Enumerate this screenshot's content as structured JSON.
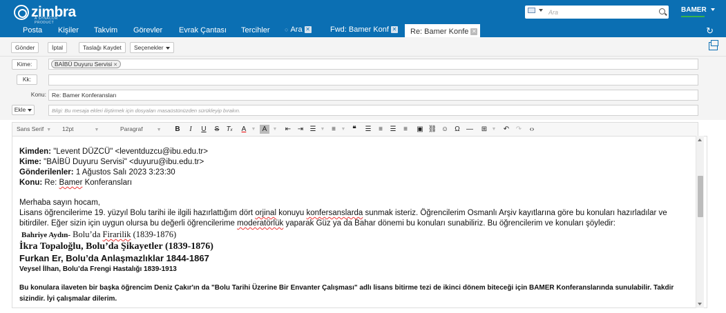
{
  "header": {
    "logo_text": "zimbra",
    "logo_subtext": "A SYNACOR PRODUCT",
    "search_placeholder": "Ara",
    "user_name": "BAMER"
  },
  "nav": {
    "items": [
      "Posta",
      "Kişiler",
      "Takvim",
      "Görevler",
      "Evrak Çantası",
      "Tercihler"
    ],
    "tabs": [
      {
        "label": "Ara",
        "active": false
      },
      {
        "label": "Fwd: Bamer Konf",
        "active": false
      },
      {
        "label": "Re: Bamer Konfe",
        "active": true
      }
    ]
  },
  "toolbar": {
    "send": "Gönder",
    "cancel": "İptal",
    "save_draft": "Taslağı Kaydet",
    "options": "Seçenekler"
  },
  "compose": {
    "to_label": "Kime:",
    "to_recipient": "BAİBÜ Duyuru Servisi",
    "cc_label": "Kk:",
    "subject_label": "Konu:",
    "subject_value": "Re: Bamer Konferansları",
    "attach_label": "Ekle",
    "attach_hint": "Bilgi: Bu mesaja ekleri iliştirmek için dosyaları masaüstünüzden sürükleyip bırakın."
  },
  "format_toolbar": {
    "font": "Sans Serif",
    "size": "12pt",
    "block": "Paragraf"
  },
  "body": {
    "from_label": "Kimden:",
    "from_value": "\"Levent DÜZCÜ\" <leventduzcu@ibu.edu.tr>",
    "to_label": "Kime:",
    "to_value": "\"BAİBÜ Duyuru Servisi\" <duyuru@ibu.edu.tr>",
    "sent_label": "Gönderilenler:",
    "sent_value": "1 Ağustos Salı 2023 3:23:30",
    "subject_label": "Konu:",
    "subject_prefix": "Re:",
    "subject_word": "Bamer",
    "subject_rest": "Konferansları",
    "greeting": "Merhaba sayın hocam,",
    "p1_a": "Lisans öğrencilerime 19. yüzyıl Bolu tarihi ile ilgili hazırlattığım dört ",
    "p1_orjinal": "orjinal",
    "p1_b": " konuyu ",
    "p1_konfersanslarda": "konfersanslarda",
    "p1_c": " sunmak isteriz. Öğrencilerim Osmanlı Arşiv kayıtlarına göre bu konuları hazırladılar ve bitirdiler. Eğer sizin için uygun olursa bu değerli öğrencilerime ",
    "p1_moderatorluk": "moderatörlük",
    "p1_d": " yaparak Güz ya da Bahar dönemi bu konuları sunabiliriz. Bu öğrencilerim ve konuları şöyledir:",
    "student1_name": "Bahriye Aydın-",
    "student1_a": " Bolu’da ",
    "student1_firarilik": "Firarilik",
    "student1_b": " (1839-1876)",
    "student2": "İkra Topaloğlu, Bolu’da Şikayetler (1839-1876)",
    "student3": "Furkan Er, Bolu’da Anlaşmazlıklar 1844-1867",
    "student4": "Veysel İlhan, Bolu’da Frengi Hastalığı 1839-1913",
    "closing": "Bu konulara ilaveten bir başka öğrencim Deniz Çakır'ın da \"Bolu Tarihi Üzerine Bir Envanter Çalışması\" adlı lisans bitirme tezi de ikinci dönem biteceği için BAMER Konferanslarında sunulabilir.  Takdir sizindir. İyi çalışmalar dilerim."
  }
}
